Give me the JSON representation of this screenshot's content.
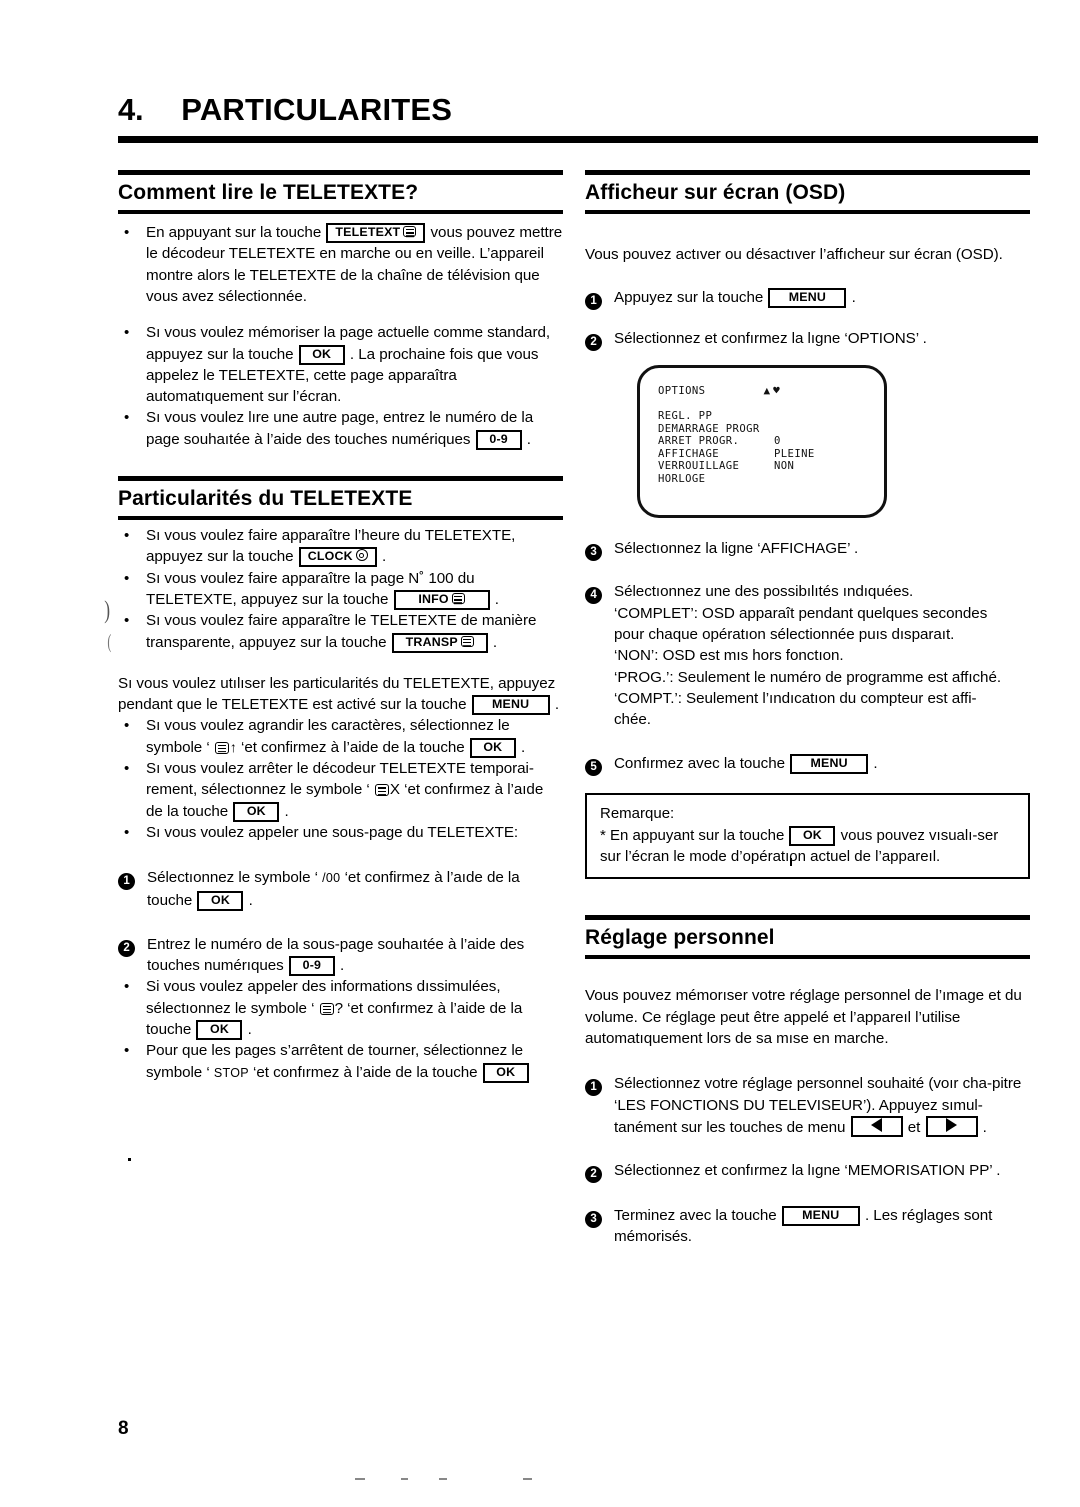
{
  "document": {
    "chapter_number": "4.",
    "chapter_title": "PARTICULARITES",
    "page_number": "8"
  },
  "left_column": {
    "section1": {
      "heading": "Comment lire le TELETEXTE?",
      "bullets": [
        {
          "pre": "En appuyant sur la touche ",
          "key": "TELETEXT",
          "key_icon": "teletext-icon",
          "post": " vous pouvez mettre le décodeur TELETEXTE en marche ou en veille. L’appareil montre alors le TELETEXTE de la chaîne de télévision que vous avez sélectionnée."
        },
        {
          "pre": "Sı vous voulez mémoriser la page actuelle comme standard, appuyez sur la touche ",
          "key": "OK",
          "post": " . La prochaine fois que vous appelez le TELETEXTE, cette page apparaîtra automatıquement sur l’écran."
        },
        {
          "pre": "Sı vous voulez lıre une autre page, entrez le numéro de la page souhaıtée à l’aide des touches numériques ",
          "key": "0-9",
          "post": " ."
        }
      ]
    },
    "section2": {
      "heading": "Particularités du TELETEXTE",
      "bullets": [
        {
          "pre": "Sı vous voulez faire apparaître l’heure du TELETEXTE, appuyez sur la touche ",
          "key": "CLOCK",
          "key_icon": "clock-icon",
          "post": " ."
        },
        {
          "pre": "Sı vous voulez faire apparaître la page N˚ 100 du TELETEXTE, appuyez sur la touche ",
          "key": "INFO",
          "key_icon": "teletext-icon",
          "post": " ."
        },
        {
          "pre": "Sı vous voulez faire apparaître le TELETEXTE de manière transparente, appuyez sur la touche ",
          "key": "TRANSP",
          "key_icon": "transp-icon",
          "post": " ."
        }
      ],
      "intro_pre": "Sı vous voulez utılıser les particularités du TELETEXTE, appuyez pendant que le TELETEXTE est activé sur la touche ",
      "intro_key": "MENU",
      "intro_post": " .",
      "bullets2": [
        {
          "pre": "Sı vous voulez agrandir les caractères, sélectionnez le symbole ‘ ",
          "symbol": "teletext-up-icon",
          "symbol_suffix": "↑",
          "mid": " ‘et confirmez à l’aide de la touche ",
          "key": "OK",
          "post": " ."
        },
        {
          "pre": "Sı vous voulez arrêter le décodeur TELETEXTE temporai-rement, sélectıonnez le symbole ‘ ",
          "symbol": "teletext-x-icon",
          "symbol_suffix": "X",
          "mid": " ‘et confırmez à l’aıde de la touche ",
          "key": "OK",
          "post": " ."
        },
        {
          "pre": "Sı vous voulez appeler une sous-page du TELETEXTE:",
          "post": ""
        }
      ],
      "steps": [
        {
          "num": "1",
          "pre": "Sélectıonnez le symbole ‘ ",
          "symbol_text": "/00",
          "mid": " ‘et confirmez à l’aıde de la touche ",
          "key": "OK",
          "post": " ."
        },
        {
          "num": "2",
          "pre": "Entrez le numéro de la sous-page souhaıtée à l’aide des touches numérıques ",
          "key": "0-9",
          "post": " ."
        }
      ],
      "bullets3": [
        {
          "pre": "Si vous voulez appeler des informations dıssimulées, sélectıonnez le symbole ‘ ",
          "symbol": "teletext-question-icon",
          "symbol_suffix": "?",
          "mid": " ‘et confırmez à l’aide de la touche ",
          "key": "OK",
          "post": " ."
        },
        {
          "pre": "Pour que les pages s’arrêtent de tourner, sélectionnez le symbole ‘ ",
          "symbol_text": "STOP",
          "mid": " ‘et confırmez à l’aide de la touche ",
          "key": "OK",
          "post": ""
        }
      ]
    }
  },
  "right_column": {
    "section1": {
      "heading": "Afficheur sur écran (OSD)",
      "intro": "Vous pouvez actıver ou désactıver l’affıcheur sur écran (OSD).",
      "steps": [
        {
          "num": "1",
          "pre": "Appuyez sur la touche ",
          "key": "MENU",
          "post": " ."
        },
        {
          "num": "2",
          "pre": "Sélectionnez et confırmez la lıgne ‘OPTIONS’ .",
          "post": ""
        }
      ],
      "osd_screen": {
        "title": "OPTIONS",
        "arrows": "▲♥",
        "rows": [
          {
            "label": "REGL. PP",
            "value": ""
          },
          {
            "label": "DEMARRAGE PROGR",
            "value": ""
          },
          {
            "label": "ARRET PROGR.",
            "value": "0"
          },
          {
            "label": "AFFICHAGE",
            "value": "PLEINE"
          },
          {
            "label": "VERROUILLAGE",
            "value": "NON"
          },
          {
            "label": "HORLOGE",
            "value": ""
          }
        ]
      },
      "steps2": [
        {
          "num": "3",
          "pre": "Sélectıonnez la ligne ‘AFFICHAGE’ .",
          "post": ""
        },
        {
          "num": "4",
          "pre": "Sélectıonnez une des possibılıtés ındıquées.",
          "lines": [
            "‘COMPLET’: OSD apparaît pendant quelques secondes",
            "pour chaque opératıon sélectionnée puıs dısparaıt.",
            "‘NON’: OSD est mıs hors fonctıon.",
            "‘PROG.’: Seulement le numéro de programme est affıché.",
            "‘COMPT.’: Seulement l’ındıcatıon du compteur est affi-",
            "chée."
          ]
        },
        {
          "num": "5",
          "pre": "Confırmez avec la touche ",
          "key": "MENU",
          "post": " ."
        }
      ],
      "remark": {
        "title": "Remarque:",
        "pre": "* En appuyant sur la touche ",
        "key": "OK",
        "post": " vous pouvez vısualı-ser sur l’écran le mode d’opératıon actuel de l’appareıl."
      }
    },
    "section2": {
      "heading": "Réglage personnel",
      "intro": "Vous pouvez mémorıser votre réglage personnel de l’ımage et du volume. Ce réglage peut être appelé et l’appareıl l’utilise automatıquement lors de sa mıse en marche.",
      "steps": [
        {
          "num": "1",
          "pre": "Sélectionnez votre réglage personnel souhaité (voır cha-pitre ‘LES FONCTIONS DU TELEVISEUR’). Appuyez sımul-tanément sur les touches de menu ",
          "key_left": "◀",
          "mid": " et ",
          "key_right": "▶",
          "post": " ."
        },
        {
          "num": "2",
          "pre": "Sélectionnez et confırmez la lıgne ‘MEMORISATION PP’ .",
          "post": ""
        },
        {
          "num": "3",
          "pre": "Terminez avec la touche ",
          "key": "MENU",
          "post": " . Les réglages sont mémorisés."
        }
      ]
    }
  }
}
